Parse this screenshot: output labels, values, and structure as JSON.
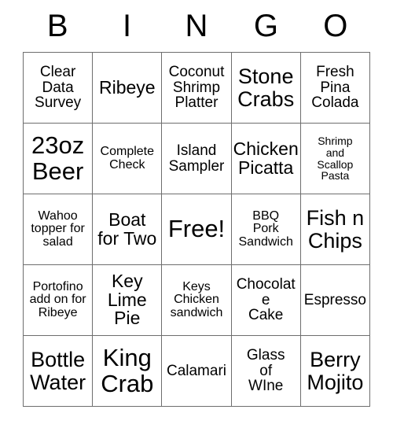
{
  "card": {
    "header_letters": [
      "B",
      "I",
      "N",
      "G",
      "O"
    ],
    "columns": 5,
    "rows": 5,
    "border_color": "#6e6e6e",
    "text_color": "#000000",
    "background_color": "#ffffff",
    "cells": [
      {
        "text": "Clear\nData\nSurvey",
        "size": "md"
      },
      {
        "text": "Ribeye",
        "size": "lg"
      },
      {
        "text": "Coconut\nShrimp\nPlatter",
        "size": "md"
      },
      {
        "text": "Stone\nCrabs",
        "size": "xl"
      },
      {
        "text": "Fresh\nPina\nColada",
        "size": "md"
      },
      {
        "text": "23oz\nBeer",
        "size": "xxl"
      },
      {
        "text": "Complete\nCheck",
        "size": "sm"
      },
      {
        "text": "Island\nSampler",
        "size": "md"
      },
      {
        "text": "Chicken\nPicatta",
        "size": "lg"
      },
      {
        "text": "Shrimp\nand\nScallop\nPasta",
        "size": "xs"
      },
      {
        "text": "Wahoo\ntopper for\nsalad",
        "size": "sm"
      },
      {
        "text": "Boat\nfor Two",
        "size": "lg"
      },
      {
        "text": "Free!",
        "size": "xxl"
      },
      {
        "text": "BBQ\nPork\nSandwich",
        "size": "sm"
      },
      {
        "text": "Fish n\nChips",
        "size": "xl"
      },
      {
        "text": "Portofino\nadd on for\nRibeye",
        "size": "sm"
      },
      {
        "text": "Key\nLime\nPie",
        "size": "lg"
      },
      {
        "text": "Keys\nChicken\nsandwich",
        "size": "sm"
      },
      {
        "text": "Chocolate\nCake",
        "size": "md"
      },
      {
        "text": "Espresso",
        "size": "md"
      },
      {
        "text": "Bottle\nWater",
        "size": "xl"
      },
      {
        "text": "King\nCrab",
        "size": "xxl"
      },
      {
        "text": "Calamari",
        "size": "md"
      },
      {
        "text": "Glass\nof\nWIne",
        "size": "md"
      },
      {
        "text": "Berry\nMojito",
        "size": "xl"
      }
    ]
  }
}
